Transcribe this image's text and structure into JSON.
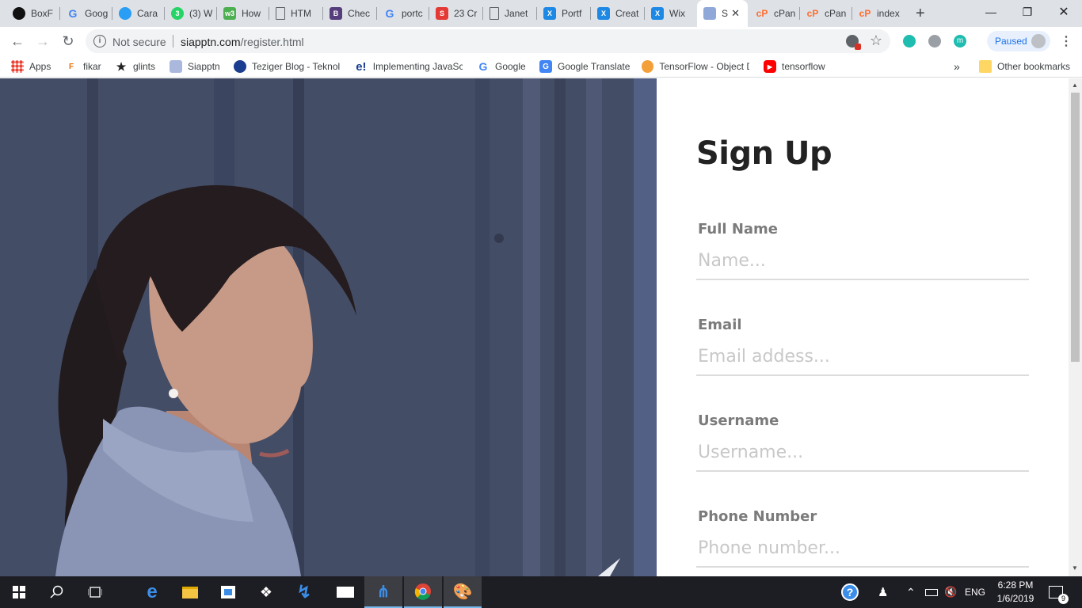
{
  "browser": {
    "tabs": [
      {
        "label": "BoxF",
        "icon": "boxfish-icon",
        "color": "#111111"
      },
      {
        "label": "Goog",
        "icon": "google-icon",
        "color": "#4285f4"
      },
      {
        "label": "Cara",
        "icon": "globe-icon",
        "color": "#2a9df4"
      },
      {
        "label": "(3) W",
        "icon": "whatsapp-icon",
        "color": "#25d366"
      },
      {
        "label": "How",
        "icon": "w3schools-icon",
        "color": "#4caf50"
      },
      {
        "label": "HTM",
        "icon": "page-icon",
        "color": "#9aa0a6"
      },
      {
        "label": "Chec",
        "icon": "bootstrap-icon",
        "color": "#563d7c"
      },
      {
        "label": "portc",
        "icon": "google-icon",
        "color": "#4285f4"
      },
      {
        "label": "23 Cr",
        "icon": "s-icon",
        "color": "#e53935"
      },
      {
        "label": "Janet",
        "icon": "page-icon",
        "color": "#9aa0a6"
      },
      {
        "label": "Portf",
        "icon": "wix-icon",
        "color": "#1e88e5"
      },
      {
        "label": "Creat",
        "icon": "wix-icon",
        "color": "#1e88e5"
      },
      {
        "label": "Wix",
        "icon": "wix-icon",
        "color": "#1e88e5"
      },
      {
        "label": "S",
        "icon": "siapptn-icon",
        "color": "#8fa8d8"
      },
      {
        "label": "cPan",
        "icon": "cpanel-icon",
        "color": "#ff6c2c"
      },
      {
        "label": "cPan",
        "icon": "cpanel-icon",
        "color": "#ff6c2c"
      },
      {
        "label": "index",
        "icon": "cpanel-icon",
        "color": "#ff6c2c"
      }
    ],
    "active_tab_index": 13,
    "address": {
      "security": "Not secure",
      "domain": "siapptn.com",
      "path": "/register.html"
    },
    "profile_status": "Paused",
    "bookmarks": [
      {
        "label": "Apps",
        "icon": "apps-grid-icon"
      },
      {
        "label": "fikar",
        "icon": "fikar-icon"
      },
      {
        "label": "glints",
        "icon": "glints-icon"
      },
      {
        "label": "Siapptn",
        "icon": "siapptn-icon"
      },
      {
        "label": "Teziger Blog - Teknol",
        "icon": "teziger-icon"
      },
      {
        "label": "Implementing JavaSc",
        "icon": "e-icon"
      },
      {
        "label": "Google",
        "icon": "google-icon"
      },
      {
        "label": "Google Translate",
        "icon": "translate-icon"
      },
      {
        "label": "TensorFlow - Object D",
        "icon": "tensorflow-icon"
      },
      {
        "label": "tensorflow",
        "icon": "youtube-icon"
      }
    ],
    "overflow": "»",
    "other_bookmarks": "Other bookmarks"
  },
  "page": {
    "title": "Sign Up",
    "fields": [
      {
        "label": "Full Name",
        "placeholder": "Name..."
      },
      {
        "label": "Email",
        "placeholder": "Email addess..."
      },
      {
        "label": "Username",
        "placeholder": "Username..."
      },
      {
        "label": "Phone Number",
        "placeholder": "Phone number..."
      }
    ]
  },
  "taskbar": {
    "language": "ENG",
    "time": "6:28 PM",
    "date": "1/6/2019",
    "notification_count": "9"
  },
  "colors": {
    "heading": "#222222",
    "label": "#7b7b7b",
    "placeholder": "#c8c8c8",
    "photo_wall": "#454e68"
  }
}
